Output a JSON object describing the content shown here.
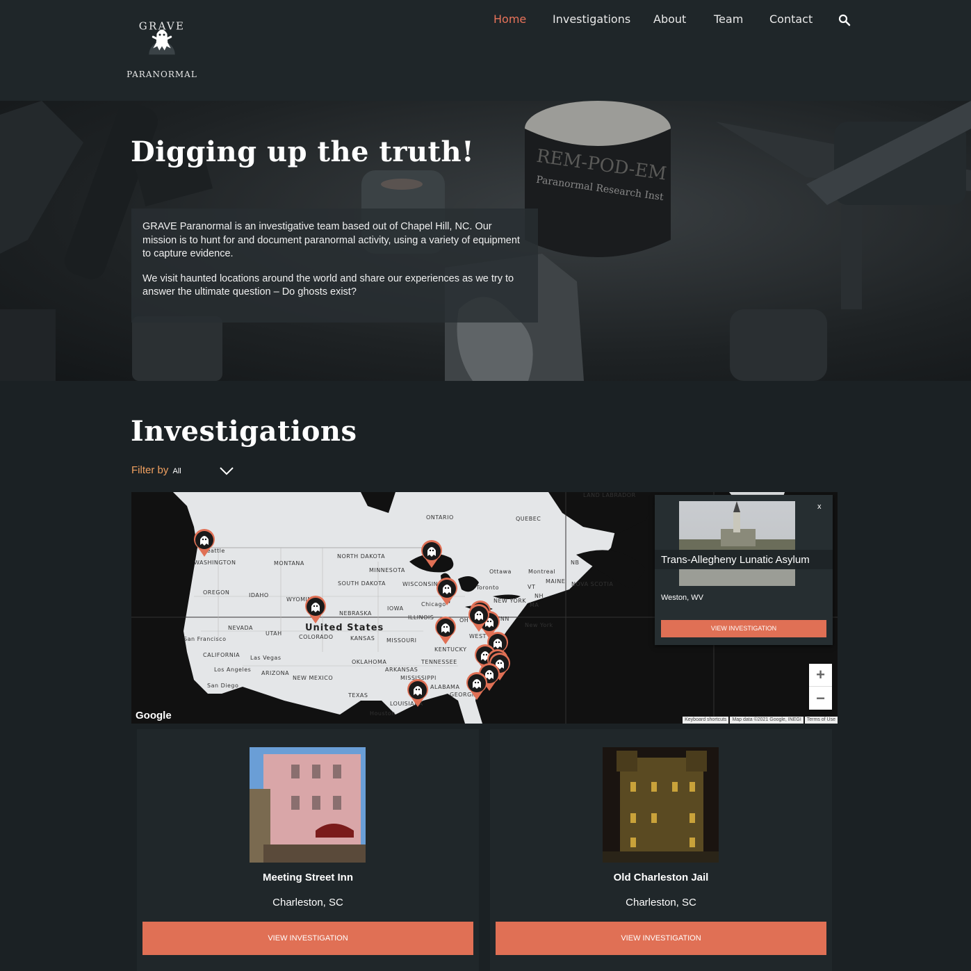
{
  "header": {
    "logo_word": "PARANORMAL",
    "logo_arc": "GRAVE",
    "nav": [
      {
        "label": "Home",
        "active": true
      },
      {
        "label": "Investigations",
        "active": false
      },
      {
        "label": "About",
        "active": false
      },
      {
        "label": "Team",
        "active": false
      },
      {
        "label": "Contact",
        "active": false
      }
    ],
    "search_icon": "search-icon"
  },
  "hero": {
    "title": "Digging up the truth!",
    "paragraph_1": "GRAVE Paranormal is an investigative team based out of Chapel Hill, NC. Our mission is to hunt for and document paranormal activity, using a variety of equipment to capture evidence.",
    "paragraph_2": "We visit haunted locations around the world and share our experiences as we try to answer the ultimate question – Do ghosts exist?",
    "device_label": "REM-POD-EM",
    "device_sublabel": "Paranormal Research Inst"
  },
  "investigations": {
    "title": "Investigations",
    "filter_label": "Filter by",
    "filter_value": "All"
  },
  "map": {
    "country_label": "United States",
    "labels": [
      "ONTARIO",
      "QUEBEC",
      "WASHINGTON",
      "MONTANA",
      "NORTH DAKOTA",
      "MINNESOTA",
      "OREGON",
      "IDAHO",
      "SOUTH DAKOTA",
      "WISCONSIN",
      "WYOMING",
      "IOWA",
      "NEBRASKA",
      "ILLINOIS",
      "NEVADA",
      "UTAH",
      "COLORADO",
      "KANSAS",
      "MISSOURI",
      "CALIFORNIA",
      "KENTUCKY",
      "TENNESSEE",
      "OKLAHOMA",
      "ARKANSAS",
      "ARIZONA",
      "NEW MEXICO",
      "MISSISSIPPI",
      "ALABAMA",
      "GEORGIA",
      "TEXAS",
      "LOUISIANA",
      "NEW YORK",
      "PENN",
      "MAINE",
      "NB",
      "NOVA SCOTIA",
      "VT",
      "NH",
      "MA",
      "WEST VIR",
      "OH",
      "Seattle",
      "San Francisco",
      "Las Vegas",
      "Los Angeles",
      "San Diego",
      "Houston",
      "Chicago",
      "Toronto",
      "Ottawa",
      "Montreal",
      "New York",
      "LAND LABRADOR"
    ],
    "logo": "Google",
    "footer": [
      "Keyboard shortcuts",
      "Map data ©2021 Google, INEGI",
      "Terms of Use"
    ],
    "zoom_in": "+",
    "zoom_out": "−",
    "popup": {
      "title": "Trans-Allegheny Lunatic Asylum",
      "location": "Weston, WV",
      "button": "VIEW INVESTIGATION",
      "close": "x"
    }
  },
  "cards": [
    {
      "name": "Meeting Street Inn",
      "location": "Charleston, SC",
      "button": "VIEW INVESTIGATION"
    },
    {
      "name": "Old Charleston Jail",
      "location": "Charleston, SC",
      "button": "VIEW INVESTIGATION"
    }
  ],
  "colors": {
    "accent": "#e8735a",
    "button": "#e07055",
    "background": "#1b2124",
    "filter": "#f0a060"
  }
}
